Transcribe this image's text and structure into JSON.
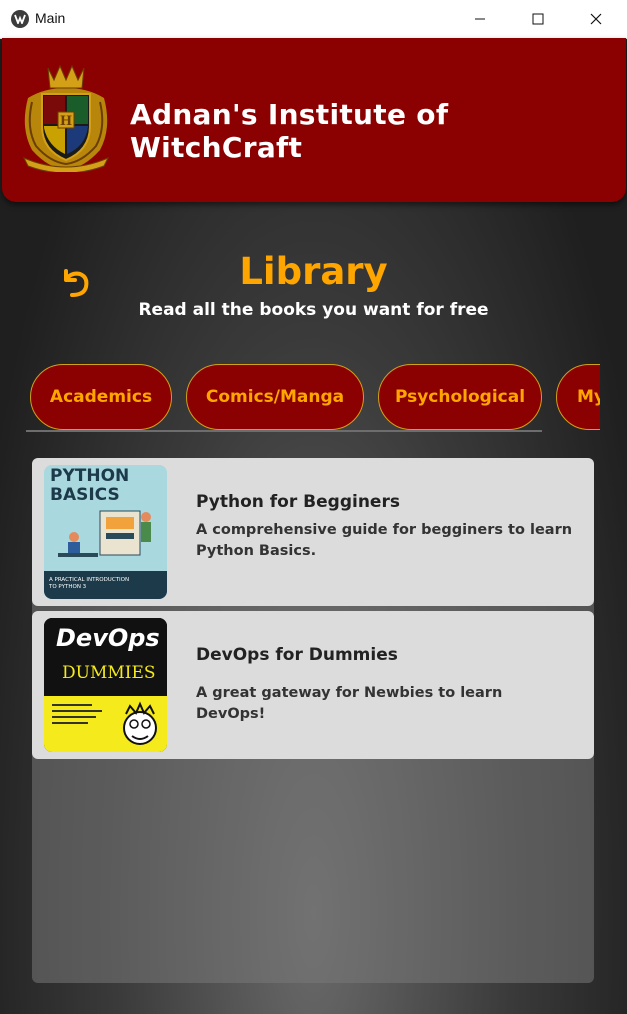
{
  "window": {
    "title": "Main",
    "controls": {
      "minimize": "minimize-icon",
      "maximize": "maximize-icon",
      "close": "close-icon"
    }
  },
  "header": {
    "institute_name": "Adnan's Institute of WitchCraft",
    "crest_icon": "hogwarts-crest-icon"
  },
  "library": {
    "title": "Library",
    "subtitle": "Read all the books you want for free",
    "back_icon": "back-arrow-icon"
  },
  "categories": [
    {
      "label": "Academics"
    },
    {
      "label": "Comics/Manga"
    },
    {
      "label": "Psychological"
    },
    {
      "label": "My"
    }
  ],
  "books": [
    {
      "title": "Python for Begginers",
      "description": "A comprehensive guide for begginers to learn Python Basics.",
      "cover": {
        "heading": "PYTHON BASICS",
        "tagline": "A PRACTICAL INTRODUCTION TO PYTHON 3"
      }
    },
    {
      "title": "DevOps for Dummies",
      "description": "A great gateway for Newbies to learn DevOps!",
      "cover": {
        "heading": "DevOps",
        "subheading": "DUMMIES"
      }
    }
  ],
  "colors": {
    "header_bg": "#8b0000",
    "accent": "#ffa500",
    "tab_border": "#d4a017",
    "card_bg": "#dcdcdc"
  }
}
